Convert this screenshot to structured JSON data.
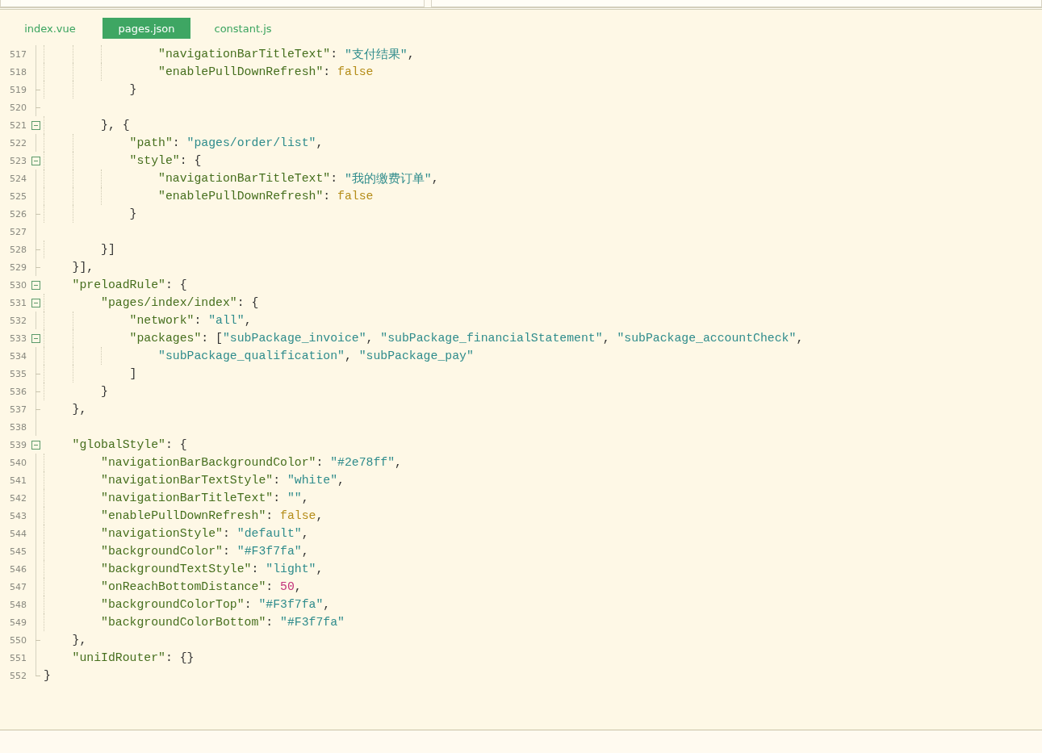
{
  "tabs": [
    {
      "label": "index.vue",
      "selected": false
    },
    {
      "label": "pages.json",
      "selected": true
    },
    {
      "label": "constant.js",
      "selected": false
    }
  ],
  "lines": [
    {
      "children": [
        {
          "children": [
            {
              "children": [
                {
                  "children": [
                    {
                      "number": "517",
                      "collapsible": false,
                      "fold_end": false,
                      "tokens": [
                        {
                          "kind": "key",
                          "text": "\"navigationBarTitleText\""
                        },
                        {
                          "kind": "punct",
                          "text": ": "
                        },
                        {
                          "kind": "string",
                          "text": "\"支付结果\""
                        },
                        {
                          "kind": "punct",
                          "text": ","
                        }
                      ]
                    },
                    {
                      "number": "518",
                      "collapsible": false,
                      "fold_end": false,
                      "tokens": [
                        {
                          "kind": "key",
                          "text": "\"enablePullDownRefresh\""
                        },
                        {
                          "kind": "punct",
                          "text": ": "
                        },
                        {
                          "kind": "bool",
                          "text": "false"
                        }
                      ]
                    }
                  ]
                },
                {
                  "number": "519",
                  "collapsible": false,
                  "fold_end": true,
                  "tokens": [
                    {
                      "kind": "punct",
                      "text": "}"
                    }
                  ]
                }
              ]
            },
            {
              "number": "520",
              "collapsible": false,
              "fold_end": true
            },
            {
              "number": "521",
              "collapsible": true,
              "tokens": [
                {
                  "kind": "punct",
                  "text": "}, {"
                }
              ],
              "children": [
                {
                  "number": "522",
                  "collapsible": false,
                  "fold_end": false,
                  "tokens": [
                    {
                      "kind": "key",
                      "text": "\"path\""
                    },
                    {
                      "kind": "punct",
                      "text": ": "
                    },
                    {
                      "kind": "string",
                      "text": "\"pages/order/list\""
                    },
                    {
                      "kind": "punct",
                      "text": ","
                    }
                  ]
                },
                {
                  "number": "523",
                  "collapsible": true,
                  "tokens": [
                    {
                      "kind": "key",
                      "text": "\"style\""
                    },
                    {
                      "kind": "punct",
                      "text": ": {"
                    }
                  ],
                  "children": [
                    {
                      "number": "524",
                      "collapsible": false,
                      "fold_end": false,
                      "tokens": [
                        {
                          "kind": "key",
                          "text": "\"navigationBarTitleText\""
                        },
                        {
                          "kind": "punct",
                          "text": ": "
                        },
                        {
                          "kind": "string",
                          "text": "\"我的缴费订单\""
                        },
                        {
                          "kind": "punct",
                          "text": ","
                        }
                      ]
                    },
                    {
                      "number": "525",
                      "collapsible": false,
                      "fold_end": false,
                      "tokens": [
                        {
                          "kind": "key",
                          "text": "\"enablePullDownRefresh\""
                        },
                        {
                          "kind": "punct",
                          "text": ": "
                        },
                        {
                          "kind": "bool",
                          "text": "false"
                        }
                      ]
                    }
                  ]
                },
                {
                  "number": "526",
                  "collapsible": false,
                  "fold_end": true,
                  "tokens": [
                    {
                      "kind": "punct",
                      "text": "}"
                    }
                  ]
                },
                {
                  "number": "527",
                  "collapsible": false,
                  "fold_end": false
                }
              ]
            },
            {
              "number": "528",
              "collapsible": false,
              "fold_end": true,
              "tokens": [
                {
                  "kind": "punct",
                  "text": "}]"
                }
              ]
            }
          ]
        },
        {
          "number": "529",
          "collapsible": false,
          "fold_end": true,
          "tokens": [
            {
              "kind": "punct",
              "text": "}],"
            }
          ]
        },
        {
          "number": "530",
          "collapsible": true,
          "tokens": [
            {
              "kind": "key",
              "text": "\"preloadRule\""
            },
            {
              "kind": "punct",
              "text": ": {"
            }
          ],
          "children": [
            {
              "number": "531",
              "collapsible": true,
              "tokens": [
                {
                  "kind": "key",
                  "text": "\"pages/index/index\""
                },
                {
                  "kind": "punct",
                  "text": ": {"
                }
              ],
              "children": [
                {
                  "number": "532",
                  "collapsible": false,
                  "fold_end": false,
                  "tokens": [
                    {
                      "kind": "key",
                      "text": "\"network\""
                    },
                    {
                      "kind": "punct",
                      "text": ": "
                    },
                    {
                      "kind": "string",
                      "text": "\"all\""
                    },
                    {
                      "kind": "punct",
                      "text": ","
                    }
                  ]
                },
                {
                  "number": "533",
                  "collapsible": true,
                  "tokens": [
                    {
                      "kind": "key",
                      "text": "\"packages\""
                    },
                    {
                      "kind": "punct",
                      "text": ": ["
                    },
                    {
                      "kind": "string",
                      "text": "\"subPackage_invoice\""
                    },
                    {
                      "kind": "punct",
                      "text": ", "
                    },
                    {
                      "kind": "string",
                      "text": "\"subPackage_financialStatement\""
                    },
                    {
                      "kind": "punct",
                      "text": ", "
                    },
                    {
                      "kind": "string",
                      "text": "\"subPackage_accountCheck\""
                    },
                    {
                      "kind": "punct",
                      "text": ","
                    }
                  ],
                  "children": [
                    {
                      "number": "534",
                      "collapsible": false,
                      "fold_end": false,
                      "tokens": [
                        {
                          "kind": "string",
                          "text": "\"subPackage_qualification\""
                        },
                        {
                          "kind": "punct",
                          "text": ", "
                        },
                        {
                          "kind": "string",
                          "text": "\"subPackage_pay\""
                        }
                      ]
                    }
                  ]
                },
                {
                  "number": "535",
                  "collapsible": false,
                  "fold_end": true,
                  "tokens": [
                    {
                      "kind": "punct",
                      "text": "]"
                    }
                  ]
                }
              ]
            },
            {
              "number": "536",
              "collapsible": false,
              "fold_end": true,
              "tokens": [
                {
                  "kind": "punct",
                  "text": "}"
                }
              ]
            }
          ]
        },
        {
          "number": "537",
          "collapsible": false,
          "fold_end": true,
          "tokens": [
            {
              "kind": "punct",
              "text": "},"
            }
          ]
        },
        {
          "number": "538",
          "collapsible": false,
          "fold_end": false
        },
        {
          "number": "539",
          "collapsible": true,
          "tokens": [
            {
              "kind": "key",
              "text": "\"globalStyle\""
            },
            {
              "kind": "punct",
              "text": ": {"
            }
          ],
          "children": [
            {
              "number": "540",
              "collapsible": false,
              "fold_end": false,
              "tokens": [
                {
                  "kind": "key",
                  "text": "\"navigationBarBackgroundColor\""
                },
                {
                  "kind": "punct",
                  "text": ": "
                },
                {
                  "kind": "string",
                  "text": "\"#2e78ff\""
                },
                {
                  "kind": "punct",
                  "text": ","
                }
              ]
            },
            {
              "number": "541",
              "collapsible": false,
              "fold_end": false,
              "tokens": [
                {
                  "kind": "key",
                  "text": "\"navigationBarTextStyle\""
                },
                {
                  "kind": "punct",
                  "text": ": "
                },
                {
                  "kind": "string",
                  "text": "\"white\""
                },
                {
                  "kind": "punct",
                  "text": ","
                }
              ]
            },
            {
              "number": "542",
              "collapsible": false,
              "fold_end": false,
              "tokens": [
                {
                  "kind": "key",
                  "text": "\"navigationBarTitleText\""
                },
                {
                  "kind": "punct",
                  "text": ": "
                },
                {
                  "kind": "string",
                  "text": "\"\""
                },
                {
                  "kind": "punct",
                  "text": ","
                }
              ]
            },
            {
              "number": "543",
              "collapsible": false,
              "fold_end": false,
              "tokens": [
                {
                  "kind": "key",
                  "text": "\"enablePullDownRefresh\""
                },
                {
                  "kind": "punct",
                  "text": ": "
                },
                {
                  "kind": "bool",
                  "text": "false"
                },
                {
                  "kind": "punct",
                  "text": ","
                }
              ]
            },
            {
              "number": "544",
              "collapsible": false,
              "fold_end": false,
              "tokens": [
                {
                  "kind": "key",
                  "text": "\"navigationStyle\""
                },
                {
                  "kind": "punct",
                  "text": ": "
                },
                {
                  "kind": "string",
                  "text": "\"default\""
                },
                {
                  "kind": "punct",
                  "text": ","
                }
              ]
            },
            {
              "number": "545",
              "collapsible": false,
              "fold_end": false,
              "tokens": [
                {
                  "kind": "key",
                  "text": "\"backgroundColor\""
                },
                {
                  "kind": "punct",
                  "text": ": "
                },
                {
                  "kind": "string",
                  "text": "\"#F3f7fa\""
                },
                {
                  "kind": "punct",
                  "text": ","
                }
              ]
            },
            {
              "number": "546",
              "collapsible": false,
              "fold_end": false,
              "tokens": [
                {
                  "kind": "key",
                  "text": "\"backgroundTextStyle\""
                },
                {
                  "kind": "punct",
                  "text": ": "
                },
                {
                  "kind": "string",
                  "text": "\"light\""
                },
                {
                  "kind": "punct",
                  "text": ","
                }
              ]
            },
            {
              "number": "547",
              "collapsible": false,
              "fold_end": false,
              "tokens": [
                {
                  "kind": "key",
                  "text": "\"onReachBottomDistance\""
                },
                {
                  "kind": "punct",
                  "text": ": "
                },
                {
                  "kind": "number",
                  "text": "50"
                },
                {
                  "kind": "punct",
                  "text": ","
                }
              ]
            },
            {
              "number": "548",
              "collapsible": false,
              "fold_end": false,
              "tokens": [
                {
                  "kind": "key",
                  "text": "\"backgroundColorTop\""
                },
                {
                  "kind": "punct",
                  "text": ": "
                },
                {
                  "kind": "string",
                  "text": "\"#F3f7fa\""
                },
                {
                  "kind": "punct",
                  "text": ","
                }
              ]
            },
            {
              "number": "549",
              "collapsible": false,
              "fold_end": false,
              "tokens": [
                {
                  "kind": "key",
                  "text": "\"backgroundColorBottom\""
                },
                {
                  "kind": "punct",
                  "text": ": "
                },
                {
                  "kind": "string",
                  "text": "\"#F3f7fa\""
                }
              ]
            }
          ]
        },
        {
          "number": "550",
          "collapsible": false,
          "fold_end": true,
          "tokens": [
            {
              "kind": "punct",
              "text": "},"
            }
          ]
        },
        {
          "number": "551",
          "collapsible": false,
          "fold_end": false,
          "tokens": [
            {
              "kind": "key",
              "text": "\"uniIdRouter\""
            },
            {
              "kind": "punct",
              "text": ": {}"
            }
          ]
        }
      ]
    },
    {
      "number": "552",
      "collapsible": false,
      "fold_end": true,
      "tokens": [
        {
          "kind": "punct",
          "text": "}"
        }
      ]
    }
  ]
}
